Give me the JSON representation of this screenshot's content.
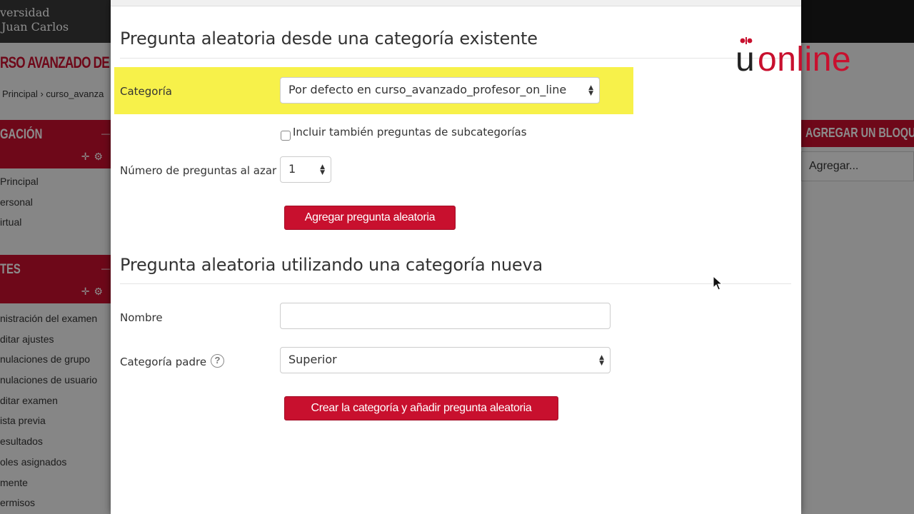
{
  "background": {
    "logo_line1": "versidad",
    "logo_line2": "Juan Carlos",
    "course_title": "RSO AVANZADO DE",
    "breadcrumb": "Principal › curso_avanza",
    "nav_block_title": "GACIÓN",
    "nav_items": [
      "Principal",
      "ersonal",
      "irtual"
    ],
    "admin_block_title": "TES",
    "admin_items": [
      "nistración del examen",
      "ditar ajustes",
      "nulaciones de grupo",
      "nulaciones de usuario",
      "ditar examen",
      "ista previa",
      "esultados",
      "oles asignados",
      "mente",
      "ermisos"
    ],
    "add_block_title": "AGREGAR UN BLOQU",
    "add_block_select": "Agregar..."
  },
  "brand": {
    "u": "u",
    "online": "online",
    "accent_color": "#c8102e"
  },
  "modal": {
    "existing_section": {
      "title": "Pregunta aleatoria desde una categoría existente",
      "category_label": "Categoría",
      "category_value": "Por defecto en curso_avanzado_profesor_on_line",
      "include_subcategories_label": "Incluir también preguntas de subcategorías",
      "include_subcategories_checked": false,
      "count_label": "Número de preguntas al azar",
      "count_value": "1",
      "add_button": "Agregar pregunta aleatoria"
    },
    "new_section": {
      "title": "Pregunta aleatoria utilizando una categoría nueva",
      "name_label": "Nombre",
      "name_value": "",
      "parent_label": "Categoría padre",
      "help_icon": "?",
      "parent_value": "Superior",
      "create_button": "Crear la categoría y añadir pregunta aleatoria"
    }
  }
}
